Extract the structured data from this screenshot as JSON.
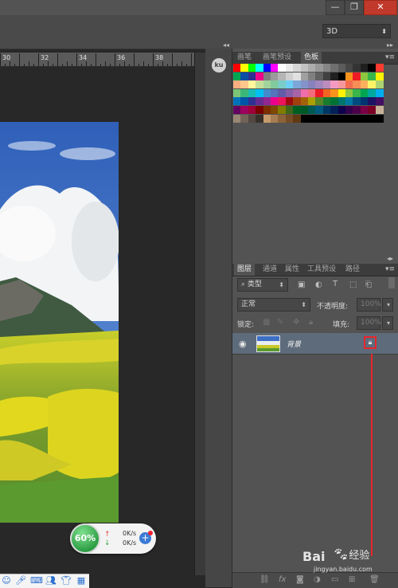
{
  "window": {
    "minimize_glyph": "—",
    "restore_glyph": "❐",
    "close_glyph": "✕"
  },
  "options_bar": {
    "workspace": "3D"
  },
  "ruler": {
    "labels": [
      "30",
      "32",
      "34",
      "36",
      "38"
    ]
  },
  "network_widget": {
    "percent": "60%",
    "upload": "0K/s",
    "download": "0K/s"
  },
  "dock": {
    "ku_label": "ku"
  },
  "swatches_panel": {
    "tabs": [
      "画笔",
      "画笔预设",
      "色板"
    ],
    "active_tab": "色板",
    "rows": [
      [
        "#ff0000",
        "#ffff00",
        "#00ff00",
        "#00ffff",
        "#0000ff",
        "#ff00ff",
        "#ffffff",
        "#ebebeb",
        "#d6d6d6",
        "#c2c2c2",
        "#adadad",
        "#999999",
        "#858585",
        "#707070",
        "#5c5c5c",
        "#474747",
        "#333333",
        "#1f1f1f",
        "#000000",
        "#ff3b30"
      ],
      [
        "#00a651",
        "#0a4fa3",
        "#2e3192",
        "#ec008c",
        "#7f7f7f",
        "#9b9b9b",
        "#b5b5b5",
        "#cfcfcf",
        "#e0e0e0",
        "#a0a0a0",
        "#808080",
        "#606060",
        "#404040",
        "#202020",
        "#000000",
        "#f7941d",
        "#ed1c24",
        "#8dc63f",
        "#39b54a",
        "#fff200"
      ],
      [
        "#f9ad81",
        "#fdc68a",
        "#fff79a",
        "#c4df9b",
        "#a3d39c",
        "#82ca9d",
        "#7accc8",
        "#6dcff6",
        "#7da7d9",
        "#8393ca",
        "#8781bd",
        "#a187be",
        "#bd8cbf",
        "#f49ac2",
        "#f5989d",
        "#f26c4f",
        "#f68e55",
        "#fbaf5d",
        "#fff467",
        "#acd372"
      ],
      [
        "#7cc576",
        "#3bb878",
        "#1abbb4",
        "#00bff3",
        "#438ccb",
        "#5574b9",
        "#605ca8",
        "#855fa8",
        "#a763a8",
        "#f06ea9",
        "#f26d7d",
        "#ed1c24",
        "#f26522",
        "#f7941d",
        "#fff200",
        "#8dc63f",
        "#39b54a",
        "#00a651",
        "#00a99d",
        "#00aeef"
      ],
      [
        "#0072bc",
        "#0054a6",
        "#2e3192",
        "#662d91",
        "#92278f",
        "#ec008c",
        "#ed145b",
        "#9e0b0f",
        "#a0410d",
        "#a36209",
        "#aba000",
        "#598527",
        "#197b30",
        "#007236",
        "#00746b",
        "#0076a3",
        "#004b80",
        "#003471",
        "#1b1464",
        "#440e62"
      ],
      [
        "#630460",
        "#9e005d",
        "#9e0039",
        "#790000",
        "#7b2e00",
        "#7d4900",
        "#827b00",
        "#406618",
        "#005e20",
        "#005826",
        "#005952",
        "#005b7f",
        "#003663",
        "#002157",
        "#0d004c",
        "#32004b",
        "#4b0049",
        "#7b0046",
        "#7a0026",
        "#c7b299"
      ],
      [
        "#998675",
        "#736357",
        "#534741",
        "#37302a",
        "#c69c6d",
        "#a67c52",
        "#8c6239",
        "#754c24",
        "#603913",
        "#000000",
        "#000000",
        "#000000",
        "#000000",
        "#000000",
        "#000000",
        "#000000",
        "#000000",
        "#000000",
        "#000000",
        "#000000"
      ]
    ]
  },
  "layers_panel": {
    "tabs": [
      "图层",
      "通道",
      "属性",
      "工具预设",
      "路径"
    ],
    "active_tab": "图层",
    "filter": "类型",
    "blend_mode": "正常",
    "opacity_label": "不透明度:",
    "opacity_value": "100%",
    "lock_label": "锁定:",
    "fill_label": "填充:",
    "fill_value": "100%",
    "layers": [
      {
        "name": "背景",
        "visible": true,
        "locked": true
      }
    ],
    "lock_icon": "lock-icon",
    "highlight_color": "#e8262b"
  },
  "watermark": {
    "logo": "Bai",
    "logo_suffix": "经验",
    "url": "jingyan.baidu.com"
  }
}
